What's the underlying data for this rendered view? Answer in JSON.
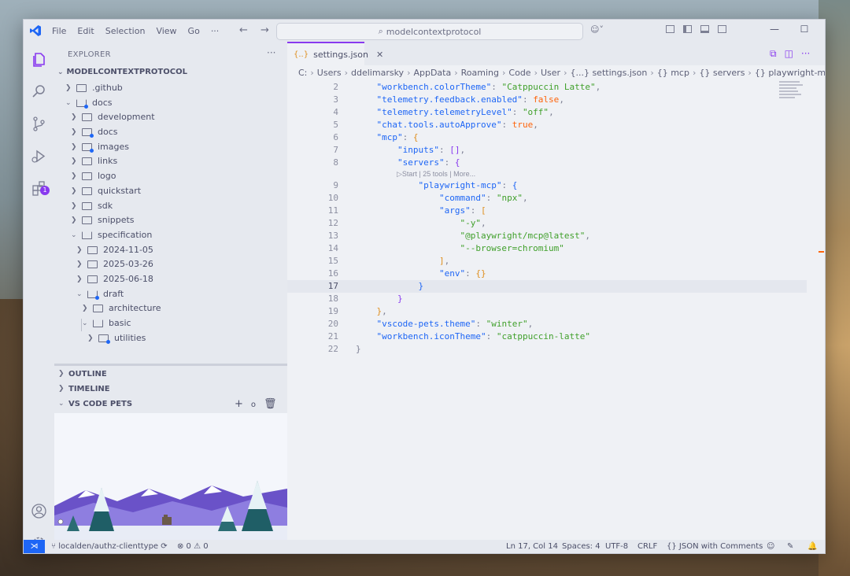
{
  "window": {
    "menu": [
      "File",
      "Edit",
      "Selection",
      "View",
      "Go",
      "···"
    ],
    "command_center": "modelcontextprotocol",
    "controls": [
      "—",
      "☐",
      "✕"
    ]
  },
  "activity_bar": {
    "extensions_badge": "1"
  },
  "sidebar": {
    "title": "EXPLORER",
    "root": "MODELCONTEXTPROTOCOL",
    "tree": [
      {
        "label": ".github",
        "depth": 1,
        "open": false,
        "special": false
      },
      {
        "label": "docs",
        "depth": 1,
        "open": true,
        "special": true
      },
      {
        "label": "development",
        "depth": 2,
        "open": false,
        "special": false
      },
      {
        "label": "docs",
        "depth": 2,
        "open": false,
        "special": true
      },
      {
        "label": "images",
        "depth": 2,
        "open": false,
        "special": true
      },
      {
        "label": "links",
        "depth": 2,
        "open": false,
        "special": false
      },
      {
        "label": "logo",
        "depth": 2,
        "open": false,
        "special": false
      },
      {
        "label": "quickstart",
        "depth": 2,
        "open": false,
        "special": false
      },
      {
        "label": "sdk",
        "depth": 2,
        "open": false,
        "special": false
      },
      {
        "label": "snippets",
        "depth": 2,
        "open": false,
        "special": false
      },
      {
        "label": "specification",
        "depth": 2,
        "open": true,
        "special": false
      },
      {
        "label": "2024-11-05",
        "depth": 3,
        "open": false,
        "special": false
      },
      {
        "label": "2025-03-26",
        "depth": 3,
        "open": false,
        "special": false
      },
      {
        "label": "2025-06-18",
        "depth": 3,
        "open": false,
        "special": false
      },
      {
        "label": "draft",
        "depth": 3,
        "open": true,
        "special": true
      },
      {
        "label": "architecture",
        "depth": 4,
        "open": false,
        "special": false
      },
      {
        "label": "basic",
        "depth": 4,
        "open": true,
        "special": false
      },
      {
        "label": "utilities",
        "depth": 5,
        "open": false,
        "special": true
      }
    ],
    "sections": {
      "outline": "OUTLINE",
      "timeline": "TIMELINE",
      "pets": "VS CODE PETS"
    }
  },
  "editor": {
    "tab_label": "settings.json",
    "breadcrumb": [
      "C:",
      "Users",
      "ddelimarsky",
      "AppData",
      "Roaming",
      "Code",
      "User",
      "{...} settings.json",
      "{} mcp",
      "{} servers",
      "{} playwright-mcp"
    ],
    "codelens": "▷Start | 25 tools | More...",
    "active_line": 17,
    "lines": [
      {
        "n": "2",
        "parts": [
          [
            "    ",
            "p"
          ],
          [
            "\"workbench.colorTheme\"",
            "k"
          ],
          [
            ": ",
            "p"
          ],
          [
            "\"Catppuccin Latte\"",
            "s"
          ],
          [
            ",",
            "p"
          ]
        ]
      },
      {
        "n": "3",
        "parts": [
          [
            "    ",
            "p"
          ],
          [
            "\"telemetry.feedback.enabled\"",
            "k"
          ],
          [
            ": ",
            "p"
          ],
          [
            "false",
            "b"
          ],
          [
            ",",
            "p"
          ]
        ]
      },
      {
        "n": "4",
        "parts": [
          [
            "    ",
            "p"
          ],
          [
            "\"telemetry.telemetryLevel\"",
            "k"
          ],
          [
            ": ",
            "p"
          ],
          [
            "\"off\"",
            "s"
          ],
          [
            ",",
            "p"
          ]
        ]
      },
      {
        "n": "5",
        "parts": [
          [
            "    ",
            "p"
          ],
          [
            "\"chat.tools.autoApprove\"",
            "k"
          ],
          [
            ": ",
            "p"
          ],
          [
            "true",
            "b"
          ],
          [
            ",",
            "p"
          ]
        ]
      },
      {
        "n": "6",
        "parts": [
          [
            "    ",
            "p"
          ],
          [
            "\"mcp\"",
            "k"
          ],
          [
            ": ",
            "p"
          ],
          [
            "{",
            "br1"
          ]
        ]
      },
      {
        "n": "7",
        "parts": [
          [
            "        ",
            "p"
          ],
          [
            "\"inputs\"",
            "k"
          ],
          [
            ": ",
            "p"
          ],
          [
            "[]",
            "br2"
          ],
          [
            ",",
            "p"
          ]
        ]
      },
      {
        "n": "8",
        "parts": [
          [
            "        ",
            "p"
          ],
          [
            "\"servers\"",
            "k"
          ],
          [
            ": ",
            "p"
          ],
          [
            "{",
            "br2"
          ]
        ]
      },
      {
        "n": "9",
        "parts": [
          [
            "            ",
            "p"
          ],
          [
            "\"playwright-mcp\"",
            "k"
          ],
          [
            ": ",
            "p"
          ],
          [
            "{",
            "br3"
          ]
        ]
      },
      {
        "n": "10",
        "parts": [
          [
            "                ",
            "p"
          ],
          [
            "\"command\"",
            "k"
          ],
          [
            ": ",
            "p"
          ],
          [
            "\"npx\"",
            "s"
          ],
          [
            ",",
            "p"
          ]
        ]
      },
      {
        "n": "11",
        "parts": [
          [
            "                ",
            "p"
          ],
          [
            "\"args\"",
            "k"
          ],
          [
            ": ",
            "p"
          ],
          [
            "[",
            "br1"
          ]
        ]
      },
      {
        "n": "12",
        "parts": [
          [
            "                    ",
            "p"
          ],
          [
            "\"-y\"",
            "s"
          ],
          [
            ",",
            "p"
          ]
        ]
      },
      {
        "n": "13",
        "parts": [
          [
            "                    ",
            "p"
          ],
          [
            "\"@playwright/mcp@latest\"",
            "s"
          ],
          [
            ",",
            "p"
          ]
        ]
      },
      {
        "n": "14",
        "parts": [
          [
            "                    ",
            "p"
          ],
          [
            "\"--browser=chromium\"",
            "s"
          ]
        ]
      },
      {
        "n": "15",
        "parts": [
          [
            "                ",
            "p"
          ],
          [
            "]",
            "br1"
          ],
          [
            ",",
            "p"
          ]
        ]
      },
      {
        "n": "16",
        "parts": [
          [
            "                ",
            "p"
          ],
          [
            "\"env\"",
            "k"
          ],
          [
            ": ",
            "p"
          ],
          [
            "{}",
            "br1"
          ]
        ]
      },
      {
        "n": "17",
        "parts": [
          [
            "            ",
            "p"
          ],
          [
            "}",
            "br3"
          ]
        ]
      },
      {
        "n": "18",
        "parts": [
          [
            "        ",
            "p"
          ],
          [
            "}",
            "br2"
          ]
        ]
      },
      {
        "n": "19",
        "parts": [
          [
            "    ",
            "p"
          ],
          [
            "}",
            "br1"
          ],
          [
            ",",
            "p"
          ]
        ]
      },
      {
        "n": "20",
        "parts": [
          [
            "    ",
            "p"
          ],
          [
            "\"vscode-pets.theme\"",
            "k"
          ],
          [
            ": ",
            "p"
          ],
          [
            "\"winter\"",
            "s"
          ],
          [
            ",",
            "p"
          ]
        ]
      },
      {
        "n": "21",
        "parts": [
          [
            "    ",
            "p"
          ],
          [
            "\"workbench.iconTheme\"",
            "k"
          ],
          [
            ": ",
            "p"
          ],
          [
            "\"catppuccin-latte\"",
            "s"
          ]
        ]
      },
      {
        "n": "22",
        "parts": [
          [
            "}",
            "p"
          ]
        ]
      }
    ]
  },
  "statusbar": {
    "branch": "localden/authz-clienttype",
    "problems": "⊗ 0 ⚠ 0",
    "position": "Ln 17, Col 14",
    "spaces": "Spaces: 4",
    "encoding": "UTF-8",
    "eol": "CRLF",
    "language": "{} JSON with Comments"
  },
  "colors": {
    "accent": "#8839ef",
    "remote": "#1e66f5",
    "keys": "#1e66f5",
    "strings": "#40a02b"
  }
}
